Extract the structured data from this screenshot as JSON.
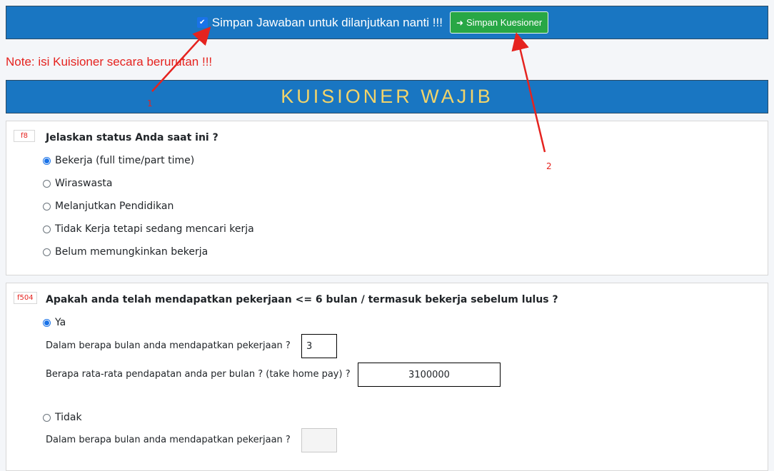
{
  "topbar": {
    "save_checkbox_label": "Simpan Jawaban untuk dilanjutkan nanti !!!",
    "save_checkbox_checked": true,
    "save_button_label": "Simpan Kuesioner",
    "save_button_icon": "sign-out-icon"
  },
  "note": "Note: isi Kuisioner secara berurutan !!!",
  "banner_title": "KUISIONER WAJIB",
  "questions": [
    {
      "code": "f8",
      "title": "Jelaskan status Anda saat ini ?",
      "options": [
        {
          "label": "Bekerja (full time/part time)",
          "selected": true
        },
        {
          "label": "Wiraswasta",
          "selected": false
        },
        {
          "label": "Melanjutkan Pendidikan",
          "selected": false
        },
        {
          "label": "Tidak Kerja tetapi sedang mencari kerja",
          "selected": false
        },
        {
          "label": "Belum memungkinkan bekerja",
          "selected": false
        }
      ]
    },
    {
      "code": "f504",
      "title": "Apakah anda telah mendapatkan pekerjaan <= 6 bulan / termasuk bekerja sebelum lulus ?",
      "yes_label": "Ya",
      "yes_selected": true,
      "months_label": "Dalam berapa bulan anda mendapatkan pekerjaan ?",
      "months_value": "3",
      "income_label": "Berapa rata-rata pendapatan anda per bulan ? (take home pay) ?",
      "income_value": "3100000",
      "no_label": "Tidak",
      "no_selected": false,
      "no_months_label": "Dalam berapa bulan anda mendapatkan pekerjaan ?",
      "no_months_value": ""
    }
  ],
  "annotations": {
    "one": "1",
    "two": "2",
    "color": "#e5231f"
  }
}
